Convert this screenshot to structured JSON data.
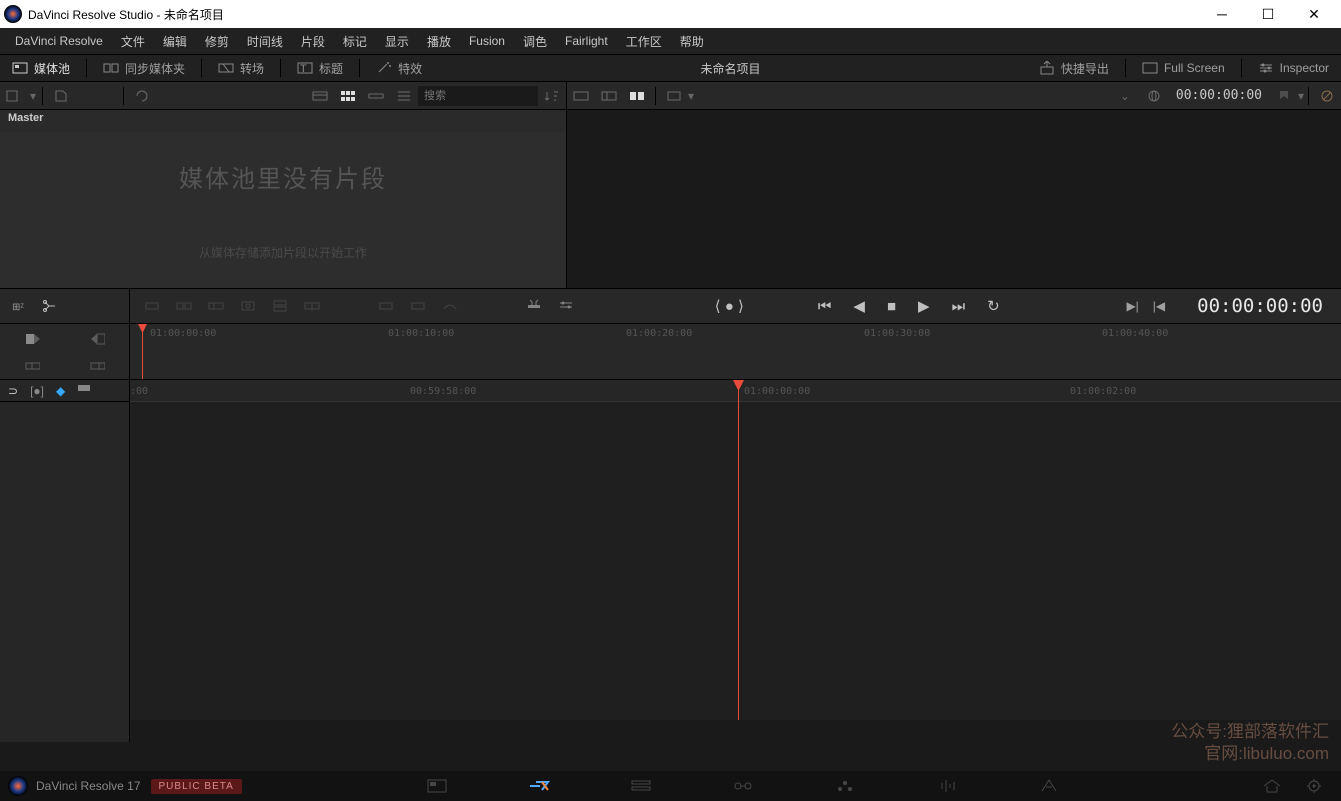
{
  "window": {
    "title": "DaVinci Resolve Studio - 未命名项目"
  },
  "menu": [
    "DaVinci Resolve",
    "文件",
    "编辑",
    "修剪",
    "时间线",
    "片段",
    "标记",
    "显示",
    "播放",
    "Fusion",
    "调色",
    "Fairlight",
    "工作区",
    "帮助"
  ],
  "toolbar": {
    "media_pool": "媒体池",
    "sync_bin": "同步媒体夹",
    "transitions": "转场",
    "titles": "标题",
    "effects": "特效",
    "project": "未命名项目",
    "quick_export": "快捷导出",
    "full_screen": "Full Screen",
    "inspector": "Inspector"
  },
  "subbar": {
    "search_placeholder": "搜索",
    "timecode": "00:00:00:00"
  },
  "pool": {
    "master": "Master",
    "empty": "媒体池里没有片段",
    "hint": "从媒体存储添加片段以开始工作"
  },
  "transport": {
    "timecode": "00:00:00:00"
  },
  "ruler_upper": [
    "01:00:00:00",
    "01:00:10:00",
    "01:00:20:00",
    "01:00:30:00",
    "01:00:40:00"
  ],
  "ruler_lower": [
    "00:59:58:00",
    "01:00:00:00",
    "01:00:02:00"
  ],
  "bottom": {
    "label": "DaVinci Resolve 17",
    "beta": "PUBLIC BETA"
  },
  "watermark": {
    "l1": "公众号:狸部落软件汇",
    "l2": "官网:libuluo.com"
  },
  "colors": {
    "accent": "#e84c3d",
    "bg": "#1a1a1a"
  }
}
